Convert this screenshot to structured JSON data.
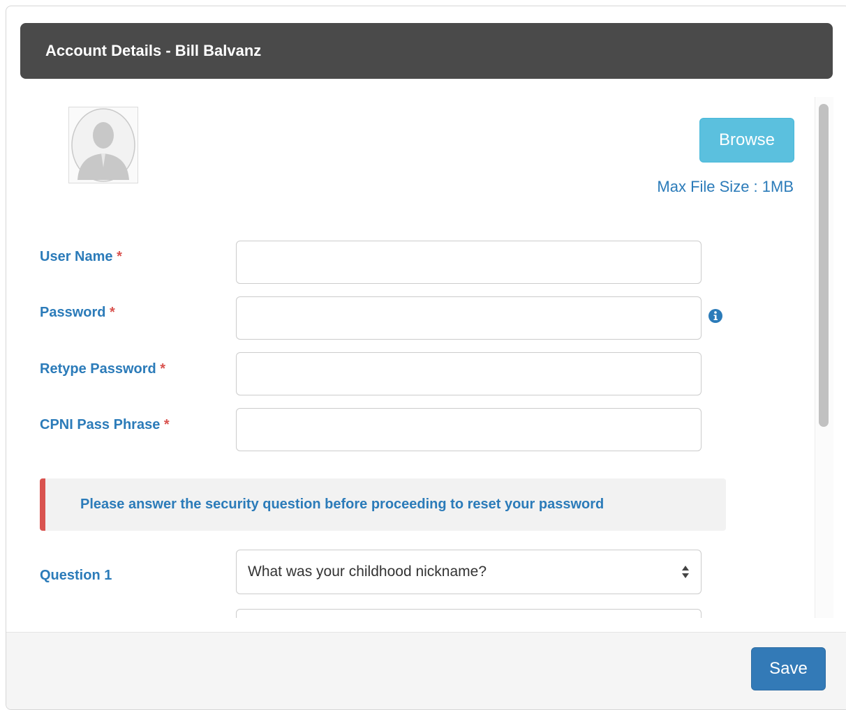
{
  "header": {
    "title": "Account Details - Bill Balvanz"
  },
  "avatar": {
    "icon": "user-avatar-placeholder-icon"
  },
  "upload": {
    "browse_label": "Browse",
    "max_file_size": "Max File Size : 1MB"
  },
  "form": {
    "required_marker": "*",
    "user_name": {
      "label": "User Name",
      "value": ""
    },
    "password": {
      "label": "Password",
      "value": "",
      "info_icon": "info-circle-icon"
    },
    "retype_password": {
      "label": "Retype Password",
      "value": ""
    },
    "cpni_pass_phrase": {
      "label": "CPNI Pass Phrase",
      "value": ""
    }
  },
  "alert": {
    "message": "Please answer the security question before proceeding to reset your password"
  },
  "security": {
    "question1": {
      "label": "Question 1",
      "selected": "What was your childhood nickname?"
    }
  },
  "footer": {
    "save_label": "Save"
  },
  "colors": {
    "header_bg": "#4a4a4a",
    "label_blue": "#2b7bb9",
    "required_red": "#d9534f",
    "browse_btn": "#5bc0de",
    "save_btn": "#337ab7"
  }
}
